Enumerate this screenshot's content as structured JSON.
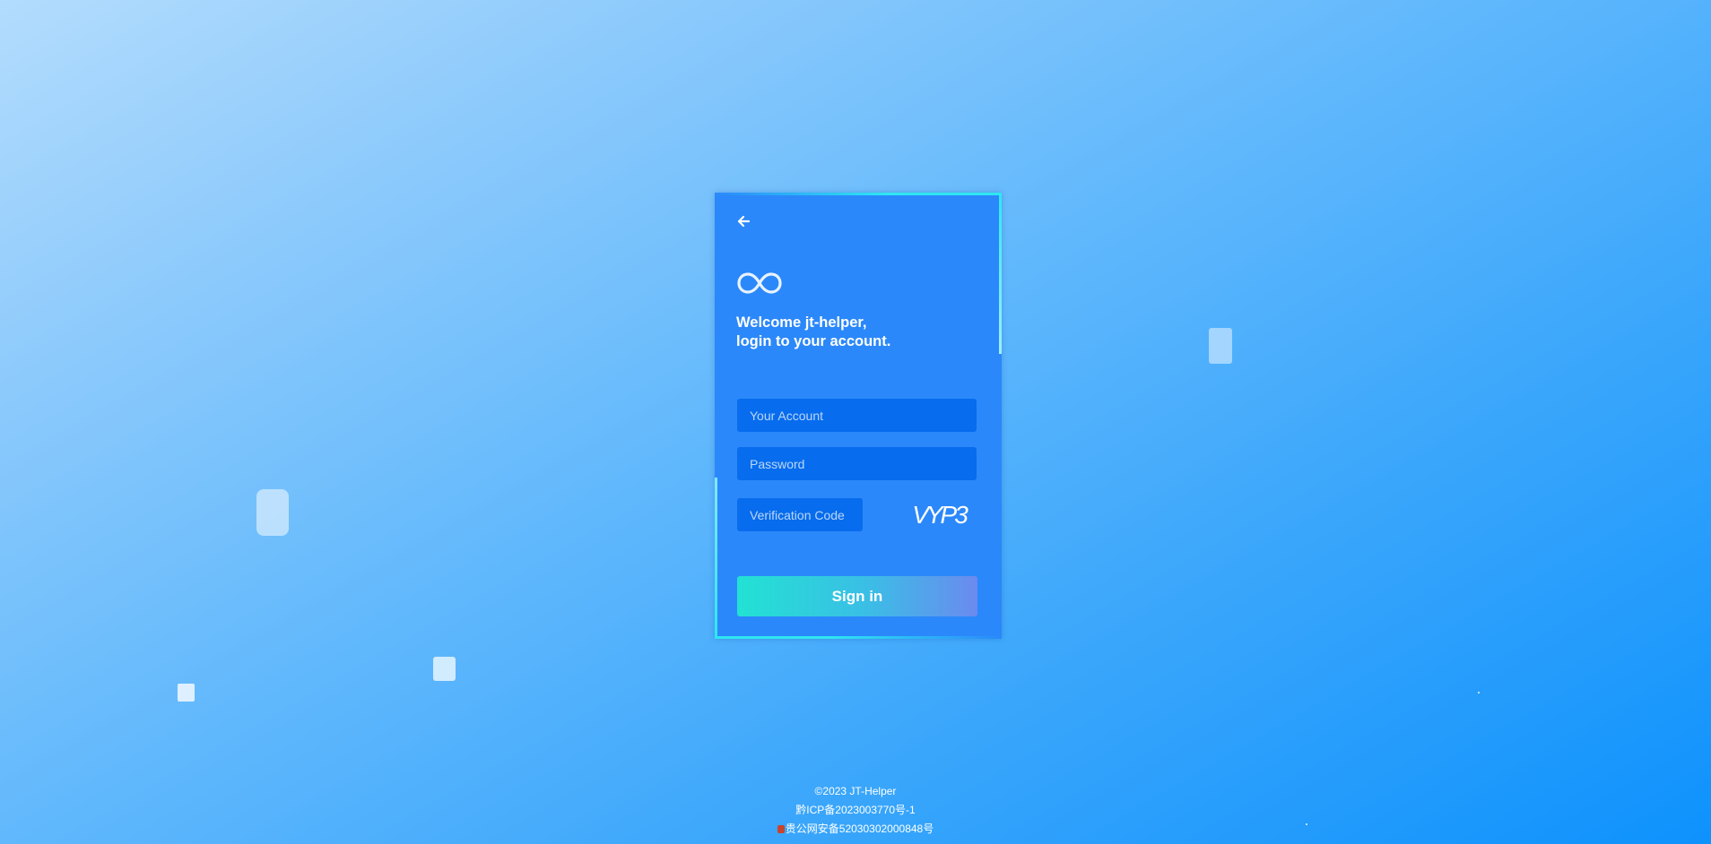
{
  "login": {
    "welcome_line1": "Welcome jt-helper,",
    "welcome_line2": "login to your account.",
    "account_placeholder": "Your Account",
    "password_placeholder": "Password",
    "code_placeholder": "Verification Code",
    "captcha_text": "VYP3",
    "signin_label": "Sign in"
  },
  "footer": {
    "copyright": "©2023 JT-Helper",
    "icp": "黔ICP备2023003770号-1",
    "police": "贵公网安备52030302000848号"
  },
  "icons": {
    "back": "arrow-left-icon",
    "logo": "infinity-logo-icon",
    "police": "police-badge-icon"
  },
  "colors": {
    "card": "#2b88fa",
    "input": "#076ced",
    "accent": "#2ee6f2"
  }
}
